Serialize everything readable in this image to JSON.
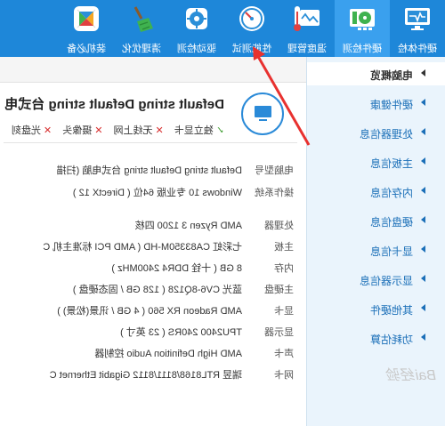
{
  "toolbar": {
    "items": [
      {
        "label": "硬件体检",
        "icon": "monitor-heart-icon"
      },
      {
        "label": "硬件检测",
        "icon": "graphics-card-icon"
      },
      {
        "label": "温度管理",
        "icon": "thermometer-icon"
      },
      {
        "label": "性能测试",
        "icon": "speedometer-icon"
      },
      {
        "label": "驱动检测",
        "icon": "gear-chip-icon"
      },
      {
        "label": "清理优化",
        "icon": "broom-icon"
      },
      {
        "label": "装机必备",
        "icon": "app-grid-icon"
      }
    ],
    "active_index": 1
  },
  "sidebar": {
    "items": [
      {
        "label": "电脑概览"
      },
      {
        "label": "硬件健康"
      },
      {
        "label": "处理器信息"
      },
      {
        "label": "主板信息"
      },
      {
        "label": "内存信息"
      },
      {
        "label": "硬盘信息"
      },
      {
        "label": "显卡信息"
      },
      {
        "label": "显示器信息"
      },
      {
        "label": "其他硬件"
      },
      {
        "label": "功耗估算"
      }
    ],
    "active_index": 0
  },
  "summary": {
    "title": "Default string Default string 台式电",
    "badges": [
      {
        "mark": "✓",
        "text": "独立显卡",
        "ok": true
      },
      {
        "mark": "✕",
        "text": "无线上网",
        "ok": false
      },
      {
        "mark": "✕",
        "text": "摄像头",
        "ok": false
      },
      {
        "mark": "✕",
        "text": "光盘刻",
        "ok": false
      }
    ]
  },
  "rows_top": [
    {
      "key": "电脑型号",
      "value": "Default string Default string 台式电脑 (扫描"
    },
    {
      "key": "操作系统",
      "value": "Windows 10 专业版 64位 ( DirectX 12 )"
    }
  ],
  "rows_hw": [
    {
      "key": "处理器",
      "value": "AMD Ryzen 3 1200 四核"
    },
    {
      "key": "主板",
      "value": "七彩虹 CA83350M-HD ( AMD PCI 标准主机 C"
    },
    {
      "key": "内存",
      "value": "8 GB ( 十铨 DDR4 2400MHz )"
    },
    {
      "key": "主硬盘",
      "value": "蓝光 CV6-8Q128 ( 128 GB / 固态硬盘 )"
    },
    {
      "key": "显卡",
      "value": "AMD Radeon RX 560 ( 4 GB / 讯景(松景) )"
    },
    {
      "key": "显示器",
      "value": "TPU2400 240RS ( 23 英寸 )"
    },
    {
      "key": "声卡",
      "value": "AMD High Definition Audio 控制器"
    },
    {
      "key": "网卡",
      "value": "瑞昱 RTL8168/8111/8112 Gigabit Ethernet C"
    }
  ],
  "watermark": "Bai经验",
  "colors": {
    "toolbar": "#1e87d9",
    "toolbar_active": "#3aa0ee",
    "sidebar_bg": "#eaf4fc",
    "accent": "#2a8ad8",
    "arrow": "#e8312f"
  }
}
